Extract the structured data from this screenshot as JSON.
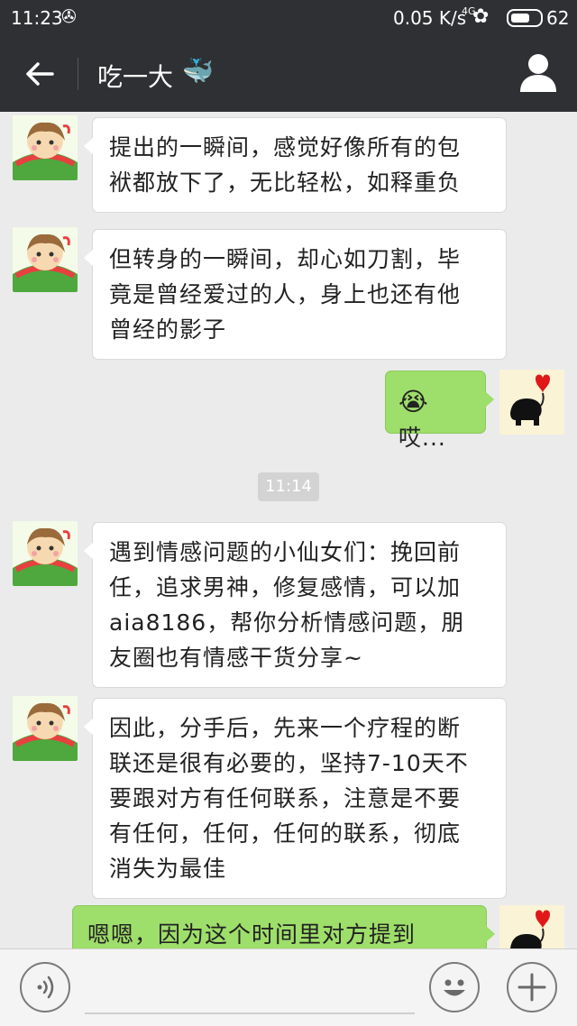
{
  "status_bar": {
    "time": "11:23",
    "notification_icon": "✇",
    "speed": "0.05 K/s",
    "network": "4G",
    "signal_icon": "✿",
    "battery": "62",
    "battery_level": 0.62
  },
  "header": {
    "title": "吃一大",
    "title_emoji": "🐳",
    "back_icon": "arrow-left-icon",
    "profile_icon": "person-icon"
  },
  "messages": [
    {
      "side": "left",
      "lines": [
        "提出的一瞬间，感觉好像所有的包",
        "袱都放下了，无比轻松，如释重负"
      ]
    },
    {
      "side": "left",
      "lines": [
        "但转身的一瞬间，却心如刀割，毕",
        "竟是曾经爱过的人，身上也还有他",
        "曾经的影子"
      ]
    },
    {
      "side": "right",
      "emoji": "😭",
      "text": "哎..."
    },
    {
      "side": "left",
      "lines": [
        "遇到情感问题的小仙女们：挽回前",
        "任，追求男神，修复感情，可以加",
        "aia8186，帮你分析情感问题，朋",
        "友圈也有情感干货分享~"
      ]
    },
    {
      "side": "left",
      "lines": [
        "因此，分手后，先来一个疗程的断",
        "联还是很有必要的，坚持7-10天不",
        "要跟对方有任何联系，注意是不要",
        "有任何，任何，任何的联系，彻底",
        "消失为最佳"
      ]
    },
    {
      "side": "right",
      "lines": [
        "嗯嗯，因为这个时间里对方提到"
      ]
    }
  ],
  "time_divider": "11:14",
  "input": {
    "placeholder": "",
    "voice_icon": "voice-icon",
    "emoji_icon": "smiley-icon",
    "plus_icon": "plus-icon"
  },
  "colors": {
    "top_bar": "#2e3033",
    "chat_bg": "#ebebeb",
    "bubble_me": "#9ede6a",
    "bubble_other": "#ffffff"
  }
}
